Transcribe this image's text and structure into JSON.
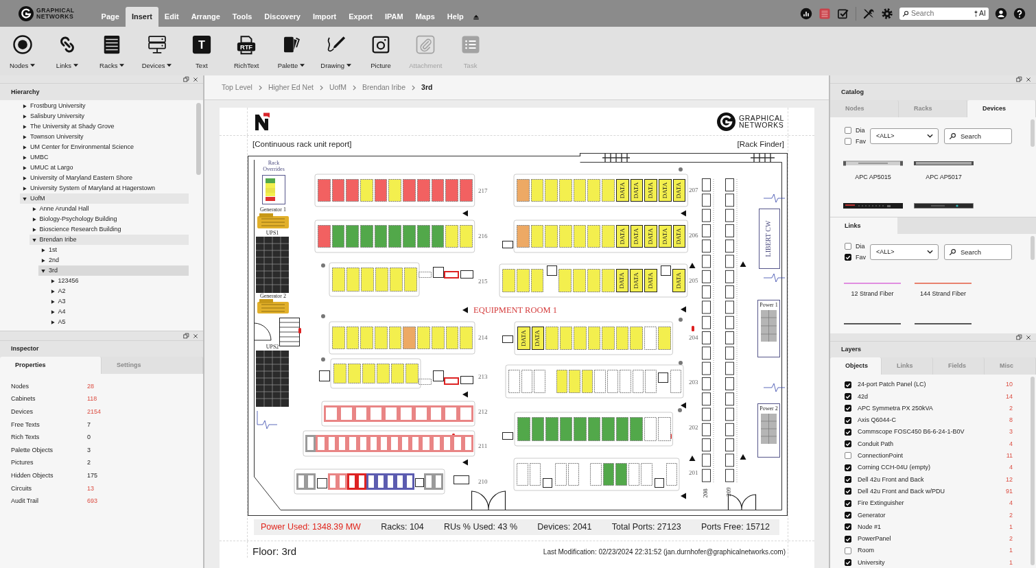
{
  "brand": {
    "line1": "GRAPHICAL",
    "line2": "NETWORKS"
  },
  "menu": [
    {
      "label": "Page",
      "selected": false
    },
    {
      "label": "Insert",
      "selected": true
    },
    {
      "label": "Edit",
      "selected": false
    },
    {
      "label": "Arrange",
      "selected": false
    },
    {
      "label": "Tools",
      "selected": false
    },
    {
      "label": "Discovery",
      "selected": false
    },
    {
      "label": "Import",
      "selected": false
    },
    {
      "label": "Export",
      "selected": false
    },
    {
      "label": "IPAM",
      "selected": false
    },
    {
      "label": "Maps",
      "selected": false
    },
    {
      "label": "Help",
      "selected": false
    }
  ],
  "search": {
    "placeholder": "Search",
    "ai": "AI"
  },
  "toolbar": [
    {
      "kind": "nodes",
      "label": "Nodes",
      "dropdown": true,
      "disabled": false
    },
    {
      "kind": "links",
      "label": "Links",
      "dropdown": true,
      "disabled": false
    },
    {
      "kind": "racks",
      "label": "Racks",
      "dropdown": true,
      "disabled": false
    },
    {
      "kind": "devices",
      "label": "Devices",
      "dropdown": true,
      "disabled": false
    },
    {
      "kind": "text",
      "label": "Text",
      "glyph": "T",
      "dropdown": false,
      "disabled": false
    },
    {
      "kind": "richtext",
      "label": "RichText",
      "glyph": "RTF",
      "dropdown": false,
      "disabled": false
    },
    {
      "kind": "palette",
      "label": "Palette",
      "dropdown": true,
      "disabled": false
    },
    {
      "kind": "drawing",
      "label": "Drawing",
      "dropdown": true,
      "disabled": false
    },
    {
      "kind": "picture",
      "label": "Picture",
      "dropdown": false,
      "disabled": false
    },
    {
      "kind": "attachment",
      "label": "Attachment",
      "dropdown": false,
      "disabled": true
    },
    {
      "kind": "task",
      "label": "Task",
      "dropdown": false,
      "disabled": true
    }
  ],
  "hierarchy": {
    "title": "Hierarchy",
    "items": [
      {
        "label": "Frostburg University",
        "expanded": false,
        "selected": false
      },
      {
        "label": "Salisbury University",
        "expanded": false,
        "selected": false
      },
      {
        "label": "The University at Shady Grove",
        "expanded": false,
        "selected": false
      },
      {
        "label": "Townson University",
        "expanded": false,
        "selected": false
      },
      {
        "label": "UM Center for Environmental Science",
        "expanded": false,
        "selected": false
      },
      {
        "label": "UMBC",
        "expanded": false,
        "selected": false
      },
      {
        "label": "UMUC at Largo",
        "expanded": false,
        "selected": false
      },
      {
        "label": "University of Maryland Eastern Shore",
        "expanded": false,
        "selected": false
      },
      {
        "label": "University System of Maryland at Hagerstown",
        "expanded": false,
        "selected": false
      },
      {
        "label": "UofM",
        "expanded": true,
        "selected": false,
        "children": [
          {
            "label": "Anne Arundal Hall",
            "expanded": false,
            "selected": false
          },
          {
            "label": "Biology-Psychology Building",
            "expanded": false,
            "selected": false
          },
          {
            "label": "Bioscience Research Building",
            "expanded": false,
            "selected": false
          },
          {
            "label": "Brendan Iribe",
            "expanded": true,
            "selected": false,
            "children": [
              {
                "label": "1st",
                "expanded": false,
                "selected": false
              },
              {
                "label": "2nd",
                "expanded": false,
                "selected": false
              },
              {
                "label": "3rd",
                "expanded": true,
                "selected": true,
                "children": [
                  {
                    "label": "123456",
                    "expanded": false,
                    "selected": false
                  },
                  {
                    "label": "A2",
                    "expanded": false,
                    "selected": false
                  },
                  {
                    "label": "A3",
                    "expanded": false,
                    "selected": false
                  },
                  {
                    "label": "A4",
                    "expanded": false,
                    "selected": false
                  },
                  {
                    "label": "A5",
                    "expanded": false,
                    "selected": false
                  }
                ]
              }
            ]
          }
        ]
      }
    ]
  },
  "inspector": {
    "title": "Inspector",
    "tabs": [
      {
        "label": "Properties",
        "selected": true
      },
      {
        "label": "Settings",
        "selected": false
      }
    ],
    "properties": [
      {
        "name": "Nodes",
        "value": "28",
        "link": true
      },
      {
        "name": "Cabinets",
        "value": "118",
        "link": true
      },
      {
        "name": "Devices",
        "value": "2154",
        "link": true
      },
      {
        "name": "Free Texts",
        "value": "7",
        "link": false
      },
      {
        "name": "Rich Texts",
        "value": "0",
        "link": false
      },
      {
        "name": "Palette Objects",
        "value": "3",
        "link": false
      },
      {
        "name": "Pictures",
        "value": "2",
        "link": false
      },
      {
        "name": "Hidden Objects",
        "value": "175",
        "link": false
      },
      {
        "name": "Circuits",
        "value": "13",
        "link": true
      },
      {
        "name": "Audit Trail",
        "value": "693",
        "link": true
      }
    ]
  },
  "breadcrumb": [
    {
      "label": "Top Level",
      "current": false
    },
    {
      "label": "Higher Ed Net",
      "current": false
    },
    {
      "label": "UofM",
      "current": false
    },
    {
      "label": "Brendan Iribe",
      "current": false
    },
    {
      "label": "3rd",
      "current": true
    }
  ],
  "sheet": {
    "brand": {
      "line1": "GRAPHICAL",
      "line2": "NETWORKS"
    },
    "report_link": "[Continuous rack unit report]",
    "finder_link": "[Rack Finder]",
    "floor_plan": {
      "room": "EQUIPMENT ROOM 1",
      "legend": "Rack Overrides",
      "labels": [
        "Generator 1",
        "UPS1",
        "Generator 2",
        "UPS2",
        "Power 1",
        "Power 2"
      ],
      "unit": "LIBERT CW",
      "columns": [
        {
          "label": "208"
        },
        {
          "label": "209"
        }
      ],
      "rows": [
        {
          "label": "217",
          "racks": [
            {
              "kind": "solid",
              "color": "#f26161"
            },
            {
              "kind": "solid",
              "color": "#f26161"
            },
            {
              "kind": "solid",
              "color": "#f26161"
            },
            {
              "kind": "solid",
              "color": "#f3ef4e"
            },
            {
              "kind": "solid",
              "color": "#f26161"
            },
            {
              "kind": "solid",
              "color": "#f3ef4e"
            },
            {
              "kind": "solid",
              "color": "#f26161"
            },
            {
              "kind": "solid",
              "color": "#f26161"
            },
            {
              "kind": "solid",
              "color": "#f26161"
            },
            {
              "kind": "solid",
              "color": "#f26161"
            },
            {
              "kind": "solid",
              "color": "#f26161"
            }
          ]
        },
        {
          "label": "216",
          "racks": [
            {
              "kind": "solid",
              "color": "#f26161"
            },
            {
              "kind": "solid",
              "color": "#52a84a"
            },
            {
              "kind": "solid",
              "color": "#52a84a"
            },
            {
              "kind": "solid",
              "color": "#52a84a"
            },
            {
              "kind": "solid",
              "color": "#52a84a"
            },
            {
              "kind": "solid",
              "color": "#52a84a"
            },
            {
              "kind": "solid",
              "color": "#52a84a"
            },
            {
              "kind": "solid",
              "color": "#52a84a"
            },
            {
              "kind": "solid",
              "color": "#52a84a"
            },
            {
              "kind": "solid",
              "color": "#f3ef4e"
            },
            {
              "kind": "solid",
              "color": "#f3ef4e"
            }
          ]
        },
        {
          "label": "215",
          "racks": [
            {
              "kind": "solid",
              "color": "#f3ef4e"
            },
            {
              "kind": "solid",
              "color": "#f3ef4e"
            },
            {
              "kind": "solid",
              "color": "#f3ef4e"
            },
            {
              "kind": "solid",
              "color": "#f3ef4e"
            },
            {
              "kind": "solid",
              "color": "#f3ef4e"
            },
            {
              "kind": "solid",
              "color": "#f3ef4e"
            }
          ]
        },
        {
          "label": "214",
          "racks": [
            {
              "kind": "solid",
              "color": "#f3ef4e"
            },
            {
              "kind": "solid",
              "color": "#f3ef4e"
            },
            {
              "kind": "solid",
              "color": "#f3ef4e"
            },
            {
              "kind": "solid",
              "color": "#f3ef4e"
            },
            {
              "kind": "solid",
              "color": "#f3ef4e"
            },
            {
              "kind": "solid",
              "color": "#eda964"
            },
            {
              "kind": "solid",
              "color": "#f3ef4e"
            },
            {
              "kind": "solid",
              "color": "#f3ef4e"
            },
            {
              "kind": "solid",
              "color": "#f3ef4e"
            },
            {
              "kind": "solid",
              "color": "#f3ef4e"
            }
          ]
        },
        {
          "label": "213",
          "racks": [
            {
              "kind": "solid",
              "color": "#f3ef4e"
            },
            {
              "kind": "solid",
              "color": "#f3ef4e"
            },
            {
              "kind": "solid",
              "color": "#f3ef4e"
            },
            {
              "kind": "solid",
              "color": "#f3ef4e"
            },
            {
              "kind": "solid",
              "color": "#f3ef4e"
            },
            {
              "kind": "solid",
              "color": "#f3ef4e"
            }
          ]
        },
        {
          "label": "212",
          "racks": [
            {
              "kind": "outline",
              "color": "#e98585"
            },
            {
              "kind": "outline",
              "color": "#e98585"
            },
            {
              "kind": "outline",
              "color": "#e98585"
            },
            {
              "kind": "outline",
              "color": "#e98585"
            },
            {
              "kind": "outline",
              "color": "#e98585"
            },
            {
              "kind": "outline",
              "color": "#e98585"
            },
            {
              "kind": "outline",
              "color": "#e98585"
            },
            {
              "kind": "outline",
              "color": "#e98585"
            },
            {
              "kind": "outline",
              "color": "#e98585"
            },
            {
              "kind": "outline",
              "color": "#e98585"
            }
          ]
        },
        {
          "label": "211",
          "racks": [
            {
              "kind": "outline",
              "color": "#9a9a9a"
            },
            {
              "kind": "outline",
              "color": "#e98585"
            },
            {
              "kind": "outline",
              "color": "#e98585"
            },
            {
              "kind": "outline",
              "color": "#e98585"
            },
            {
              "kind": "outline",
              "color": "#e98585"
            },
            {
              "kind": "outline",
              "color": "#e98585"
            },
            {
              "kind": "outline",
              "color": "#e98585"
            },
            {
              "kind": "outline",
              "color": "#e98585"
            },
            {
              "kind": "outline",
              "color": "#e98585"
            },
            {
              "kind": "outline",
              "color": "#e98585"
            },
            {
              "kind": "outline",
              "color": "#e98585"
            },
            {
              "kind": "outline",
              "color": "#e98585"
            },
            {
              "kind": "outline",
              "color": "#e98585"
            },
            {
              "kind": "outline",
              "color": "#e98585"
            },
            {
              "kind": "outline",
              "color": "#e98585"
            },
            {
              "kind": "outline",
              "color": "#e98585"
            }
          ]
        },
        {
          "label": "210",
          "racks": [
            {
              "kind": "outline",
              "color": "#9a9a9a"
            },
            {
              "kind": "outline",
              "color": "#9a9a9a"
            },
            {
              "kind": "outline",
              "color": "#e98585"
            },
            {
              "kind": "outline",
              "color": "#e98585"
            },
            {
              "kind": "outline",
              "color": "#dd2222"
            },
            {
              "kind": "outline",
              "color": "#dd2222"
            },
            {
              "kind": "outline",
              "color": "#5c5cb0"
            },
            {
              "kind": "outline",
              "color": "#5c5cb0"
            },
            {
              "kind": "outline",
              "color": "#5c5cb0"
            },
            {
              "kind": "outline",
              "color": "#5c5cb0"
            },
            {
              "kind": "outline",
              "color": "#5c5cb0"
            },
            {
              "kind": "outline",
              "color": "#9a9a9a"
            },
            {
              "kind": "outline",
              "color": "#9a9a9a"
            }
          ]
        },
        {
          "label": "207",
          "racks": [
            {
              "kind": "solid",
              "color": "#eda964"
            },
            {
              "kind": "solid",
              "color": "#f3ef4e"
            },
            {
              "kind": "solid",
              "color": "#f3ef4e"
            },
            {
              "kind": "solid",
              "color": "#f3ef4e"
            },
            {
              "kind": "solid",
              "color": "#f3ef4e"
            },
            {
              "kind": "solid",
              "color": "#f3ef4e"
            },
            {
              "kind": "solid",
              "color": "#f3ef4e"
            },
            {
              "kind": "solid",
              "color": "#f3ef4e",
              "label": "DATA"
            },
            {
              "kind": "solid",
              "color": "#f3ef4e",
              "label": "DATA"
            },
            {
              "kind": "solid",
              "color": "#f3ef4e",
              "label": "DATA"
            },
            {
              "kind": "solid",
              "color": "#f3ef4e",
              "label": "DATA"
            },
            {
              "kind": "solid",
              "color": "#f3ef4e",
              "label": "DATA"
            }
          ]
        },
        {
          "label": "206",
          "racks": [
            {
              "kind": "solid",
              "color": "#eda964"
            },
            {
              "kind": "solid",
              "color": "#f3ef4e"
            },
            {
              "kind": "solid",
              "color": "#f3ef4e"
            },
            {
              "kind": "solid",
              "color": "#f3ef4e"
            },
            {
              "kind": "solid",
              "color": "#f3ef4e"
            },
            {
              "kind": "solid",
              "color": "#f3ef4e"
            },
            {
              "kind": "solid",
              "color": "#f3ef4e"
            },
            {
              "kind": "solid",
              "color": "#f3ef4e",
              "label": "DATA"
            },
            {
              "kind": "solid",
              "color": "#f3ef4e",
              "label": "DATA"
            },
            {
              "kind": "solid",
              "color": "#f3ef4e",
              "label": "DATA"
            },
            {
              "kind": "solid",
              "color": "#f3ef4e",
              "label": "DATA"
            },
            {
              "kind": "solid",
              "color": "#f3ef4e",
              "label": "DATA"
            }
          ]
        },
        {
          "label": "205",
          "racks": [
            {
              "kind": "solid",
              "color": "#f3ef4e"
            },
            {
              "kind": "solid",
              "color": "#f3ef4e"
            },
            {
              "kind": "solid",
              "color": "#f3ef4e"
            },
            {
              "kind": "solid",
              "color": "#f3ef4e"
            },
            {
              "kind": "solid",
              "color": "#f3ef4e"
            },
            {
              "kind": "solid",
              "color": "#f3ef4e"
            },
            {
              "kind": "solid",
              "color": "#f3ef4e"
            },
            {
              "kind": "solid",
              "color": "#f3ef4e",
              "label": "DATA"
            },
            {
              "kind": "solid",
              "color": "#f3ef4e",
              "label": "DATA"
            },
            {
              "kind": "solid",
              "color": "#f3ef4e",
              "label": "DATA"
            },
            {
              "kind": "solid",
              "color": "#f3ef4e",
              "label": "DATA"
            }
          ]
        },
        {
          "label": "204",
          "racks": [
            {
              "kind": "solid",
              "color": "#f3ef4e",
              "label": "DATA"
            },
            {
              "kind": "solid",
              "color": "#f3ef4e",
              "label": "DATA"
            },
            {
              "kind": "solid",
              "color": "#f3ef4e"
            },
            {
              "kind": "solid",
              "color": "#f3ef4e"
            },
            {
              "kind": "solid",
              "color": "#f3ef4e"
            },
            {
              "kind": "solid",
              "color": "#f3ef4e"
            },
            {
              "kind": "solid",
              "color": "#f3ef4e"
            },
            {
              "kind": "solid",
              "color": "#f3ef4e"
            },
            {
              "kind": "solid",
              "color": "#f3ef4e"
            },
            {
              "kind": "solid",
              "color": "#ffffff"
            },
            {
              "kind": "solid",
              "color": "#f3ef4e"
            }
          ]
        },
        {
          "label": "203",
          "racks": [
            {
              "kind": "solid",
              "color": "#ffffff"
            },
            {
              "kind": "solid",
              "color": "#ffffff"
            },
            {
              "kind": "solid",
              "color": "#ffffff"
            },
            {
              "kind": "solid",
              "color": "#f3ef4e"
            },
            {
              "kind": "solid",
              "color": "#f3ef4e"
            },
            {
              "kind": "solid",
              "color": "#f3ef4e"
            },
            {
              "kind": "solid",
              "color": "#ffffff"
            },
            {
              "kind": "solid",
              "color": "#ffffff"
            },
            {
              "kind": "solid",
              "color": "#ffffff"
            },
            {
              "kind": "solid",
              "color": "#ffffff"
            },
            {
              "kind": "solid",
              "color": "#ffffff"
            },
            {
              "kind": "solid",
              "color": "#ffffff"
            }
          ]
        },
        {
          "label": "202",
          "racks": [
            {
              "kind": "solid",
              "color": "#52a84a"
            },
            {
              "kind": "solid",
              "color": "#52a84a"
            },
            {
              "kind": "solid",
              "color": "#52a84a"
            },
            {
              "kind": "solid",
              "color": "#52a84a"
            },
            {
              "kind": "solid",
              "color": "#52a84a"
            },
            {
              "kind": "solid",
              "color": "#52a84a"
            },
            {
              "kind": "solid",
              "color": "#52a84a"
            },
            {
              "kind": "solid",
              "color": "#52a84a"
            },
            {
              "kind": "solid",
              "color": "#52a84a"
            },
            {
              "kind": "solid",
              "color": "#ffffff"
            },
            {
              "kind": "solid",
              "color": "#ffffff"
            }
          ]
        },
        {
          "label": "201",
          "racks": [
            {
              "kind": "solid",
              "color": "#ffffff"
            },
            {
              "kind": "solid",
              "color": "#ffffff"
            },
            {
              "kind": "solid",
              "color": "#ffffff"
            },
            {
              "kind": "solid",
              "color": "#ffffff"
            },
            {
              "kind": "solid",
              "color": "#ffffff"
            },
            {
              "kind": "solid",
              "color": "#52a84a"
            },
            {
              "kind": "solid",
              "color": "#52a84a"
            },
            {
              "kind": "solid",
              "color": "#ffffff"
            },
            {
              "kind": "solid",
              "color": "#ffffff"
            },
            {
              "kind": "solid",
              "color": "#ffffff"
            }
          ]
        }
      ]
    },
    "stats": [
      {
        "text": "Power Used: 1348.39 MW",
        "alert": true
      },
      {
        "text": "Racks: 104",
        "alert": false
      },
      {
        "text": "RUs % Used: 43 %",
        "alert": false
      },
      {
        "text": "Devices: 2041",
        "alert": false
      },
      {
        "text": "Total Ports: 27123",
        "alert": false
      },
      {
        "text": "Ports Free: 15712",
        "alert": false
      }
    ],
    "floor": "Floor: 3rd",
    "last_modification": "Last Modification: 02/23/2024 22:31:52 (jan.durnhofer@graphicalnetworks.com)"
  },
  "catalog": {
    "title": "Catalog",
    "tabs": [
      {
        "label": "Nodes",
        "selected": false
      },
      {
        "label": "Racks",
        "selected": false
      },
      {
        "label": "Devices",
        "selected": true
      }
    ],
    "filters": [
      {
        "label": "Dia",
        "checked": false
      },
      {
        "label": "Fav",
        "checked": false
      }
    ],
    "select": "<ALL>",
    "search": "Search",
    "items": [
      {
        "kind": "silver-pdu",
        "label": "APC AP5015"
      },
      {
        "kind": "grey-pdu",
        "label": "APC AP5017"
      },
      {
        "kind": "black-switch"
      },
      {
        "kind": "black-server"
      }
    ]
  },
  "links": {
    "title": "Links",
    "filters": [
      {
        "label": "Dia",
        "checked": false
      },
      {
        "label": "Fav",
        "checked": true
      }
    ],
    "select": "<ALL>",
    "search": "Search",
    "items": [
      {
        "label": "12 Strand Fiber",
        "color": "#e08ee0"
      },
      {
        "label": "144 Strand Fiber",
        "color": "#e8826e"
      },
      {
        "color": "#555555"
      },
      {
        "color": "#555555"
      }
    ]
  },
  "layers": {
    "title": "Layers",
    "tabs": [
      {
        "label": "Objects",
        "selected": true
      },
      {
        "label": "Links",
        "selected": false
      },
      {
        "label": "Fields",
        "selected": false
      },
      {
        "label": "Misc",
        "selected": false
      }
    ],
    "items": [
      {
        "name": "24-port Patch Panel (LC)",
        "count": "10",
        "checked": true
      },
      {
        "name": "42d",
        "count": "14",
        "checked": true
      },
      {
        "name": "APC Symmetra PX 250kVA",
        "count": "2",
        "checked": true
      },
      {
        "name": "Axis Q6044-C",
        "count": "8",
        "checked": true
      },
      {
        "name": "Commscope FOSC450 B6-6-24-1-B0V",
        "count": "3",
        "checked": true
      },
      {
        "name": "Conduit Path",
        "count": "4",
        "checked": true
      },
      {
        "name": "ConnectionPoint",
        "count": "11",
        "checked": false
      },
      {
        "name": "Corning CCH-04U (empty)",
        "count": "4",
        "checked": true
      },
      {
        "name": "Dell 42u Front and Back",
        "count": "12",
        "checked": true
      },
      {
        "name": "Dell 42u Front and Back w/PDU",
        "count": "91",
        "checked": true
      },
      {
        "name": "Fire Extinguisher",
        "count": "4",
        "checked": true
      },
      {
        "name": "Generator",
        "count": "2",
        "checked": true
      },
      {
        "name": "Node #1",
        "count": "1",
        "checked": true
      },
      {
        "name": "PowerPanel",
        "count": "2",
        "checked": true
      },
      {
        "name": "Room",
        "count": "1",
        "checked": false
      },
      {
        "name": "University",
        "count": "1",
        "checked": true
      }
    ]
  }
}
